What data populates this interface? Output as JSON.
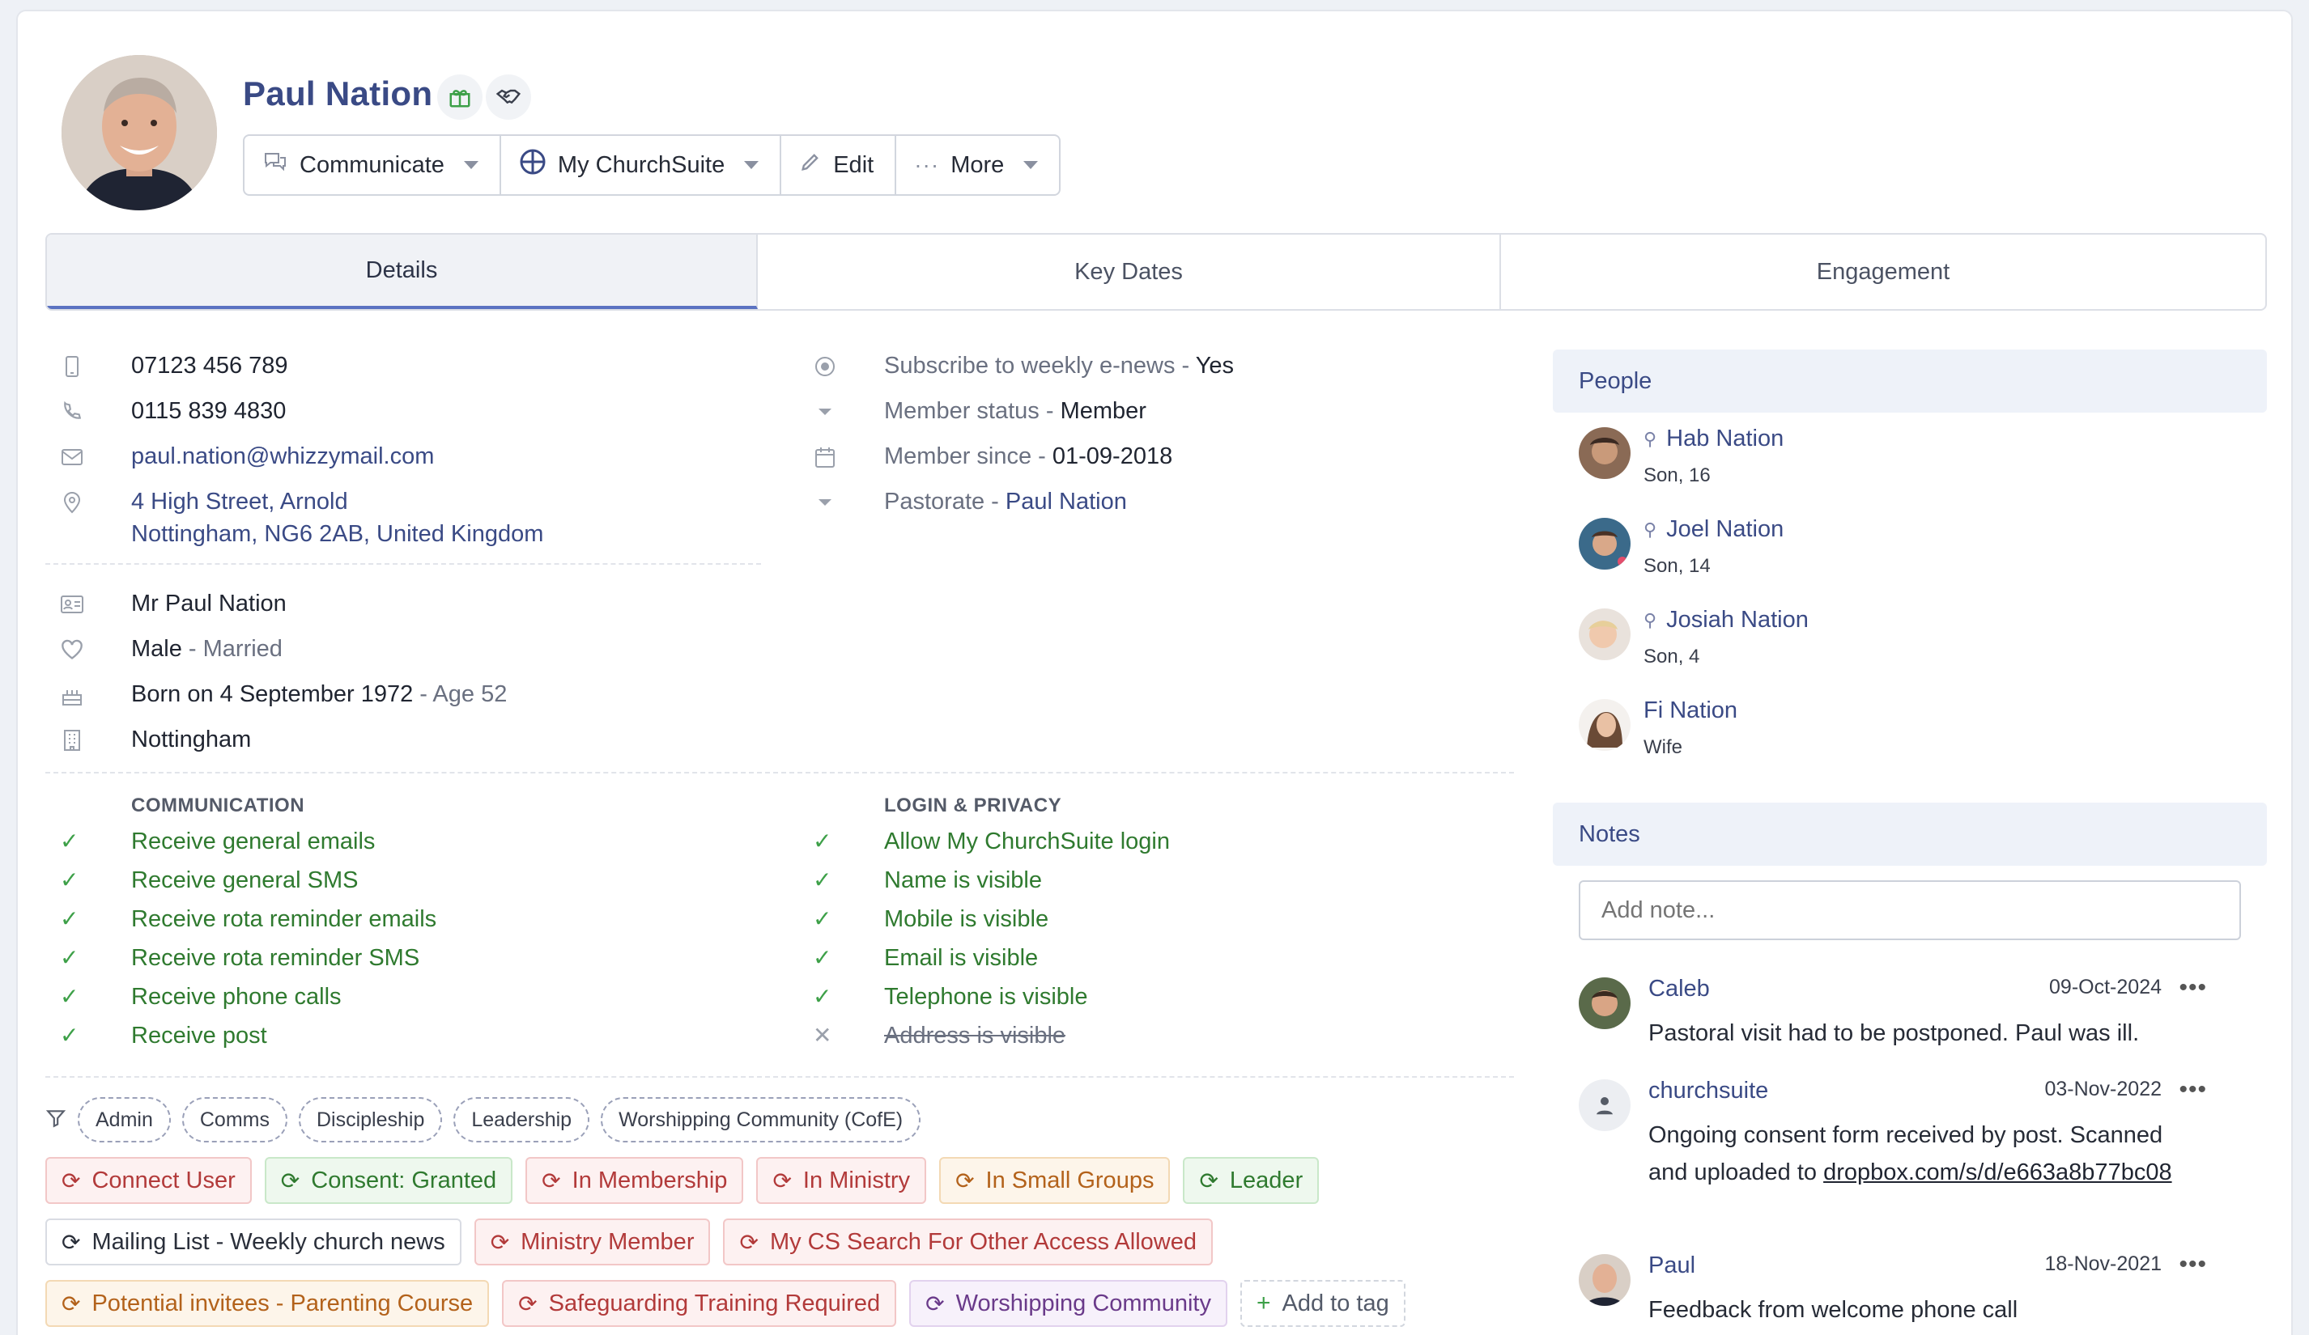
{
  "profile": {
    "name": "Paul Nation"
  },
  "actions": {
    "communicate": "Communicate",
    "my_churchsuite": "My ChurchSuite",
    "edit": "Edit",
    "more": "More"
  },
  "tabs": [
    "Details",
    "Key Dates",
    "Engagement"
  ],
  "contact": {
    "mobile": "07123 456 789",
    "telephone": "0115 839 4830",
    "email": "paul.nation@whizzymail.com",
    "address_line1": "4 High Street, Arnold",
    "address_line2": "Nottingham, NG6 2AB, United Kingdom"
  },
  "fields": {
    "subscribe_label": "Subscribe to weekly e-news - ",
    "subscribe_value": "Yes",
    "member_status_label": "Member status - ",
    "member_status_value": "Member",
    "member_since_label": "Member since - ",
    "member_since_value": "01-09-2018",
    "pastorate_label": "Pastorate - ",
    "pastorate_value": "Paul Nation"
  },
  "personal": {
    "formal_name": "Mr Paul Nation",
    "sex": "Male",
    "marital": " - Married",
    "born": "Born on 4 September 1972",
    "age": " - Age 52",
    "site": "Nottingham"
  },
  "communication": {
    "title": "COMMUNICATION",
    "items": [
      "Receive general emails",
      "Receive general SMS",
      "Receive rota reminder emails",
      "Receive rota reminder SMS",
      "Receive phone calls",
      "Receive post"
    ]
  },
  "privacy": {
    "title": "LOGIN & PRIVACY",
    "items": [
      "Allow My ChurchSuite login",
      "Name is visible",
      "Mobile is visible",
      "Email is visible",
      "Telephone is visible",
      "Address is visible"
    ]
  },
  "filters": [
    "Admin",
    "Comms",
    "Discipleship",
    "Leadership",
    "Worshipping Community (CofE)"
  ],
  "tags": {
    "row1": [
      "Connect User",
      "Consent: Granted",
      "In Membership",
      "In Ministry",
      "In Small Groups",
      "Leader"
    ],
    "row2": [
      "Mailing List - Weekly church news",
      "Ministry Member",
      "My CS Search For Other Access Allowed"
    ],
    "row3": [
      "Potential invitees - Parenting Course",
      "Safeguarding Training Required",
      "Worshipping Community"
    ],
    "add_label": "Add to tag"
  },
  "people": {
    "title": "People",
    "items": [
      {
        "name": "Hab Nation",
        "role": "Son, 16"
      },
      {
        "name": "Joel Nation",
        "role": "Son, 14"
      },
      {
        "name": "Josiah Nation",
        "role": "Son, 4"
      },
      {
        "name": "Fi Nation",
        "role": "Wife"
      }
    ]
  },
  "notes": {
    "title": "Notes",
    "placeholder": "Add note...",
    "items": [
      {
        "author": "Caleb",
        "date": "09-Oct-2024",
        "body": "Pastoral visit had to be postponed. Paul was ill."
      },
      {
        "author": "churchsuite",
        "date": "03-Nov-2022",
        "body": "Ongoing consent form received by post. Scanned and uploaded to ",
        "link": "dropbox.com/s/d/e663a8b77bc08"
      },
      {
        "author": "Paul",
        "date": "18-Nov-2021",
        "body": "Feedback from welcome phone call"
      }
    ]
  },
  "colors": {
    "brand": "#3a4a85",
    "check": "#3da048",
    "tab_active_underline": "#5b73c2"
  }
}
